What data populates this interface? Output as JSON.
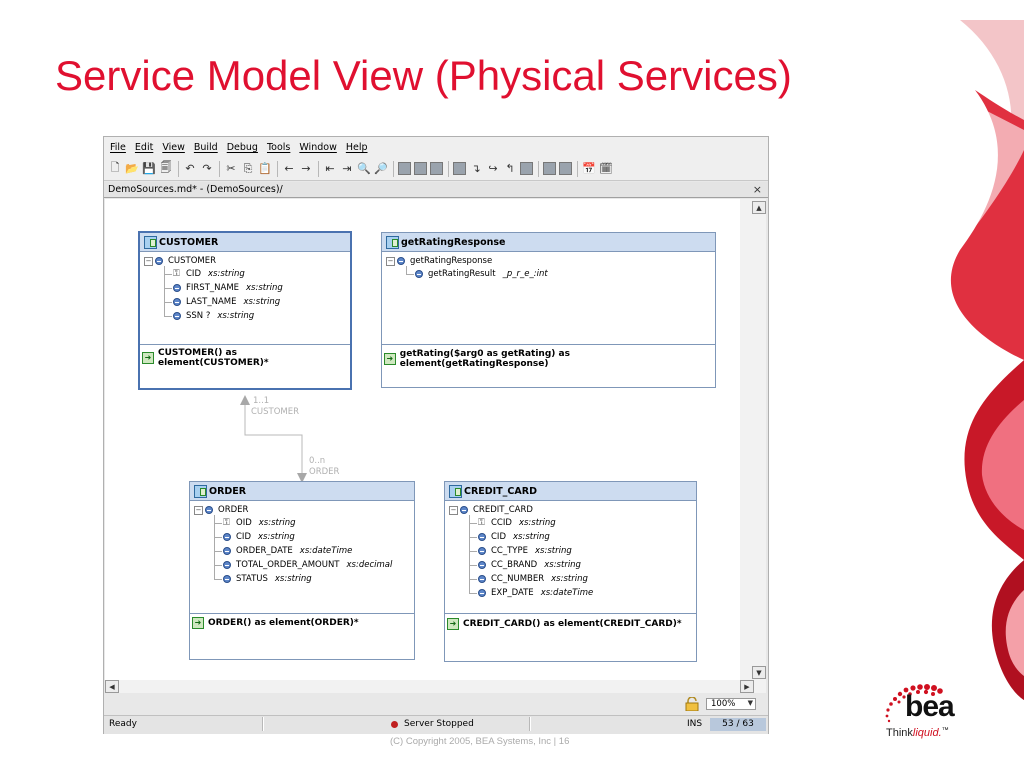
{
  "slide": {
    "title": "Service Model View (Physical Services)",
    "footer": "(C) Copyright 2005, BEA Systems, Inc   |   16",
    "logo": {
      "brand": "bea",
      "tagline_think": "Think",
      "tagline_liquid": "liquid.",
      "tm": "™"
    },
    "colors": {
      "title": "#e01030",
      "accent_red": "#d01020"
    }
  },
  "app": {
    "menu": [
      "File",
      "Edit",
      "View",
      "Build",
      "Debug",
      "Tools",
      "Window",
      "Help"
    ],
    "toolbar_icons": [
      "new-file-icon",
      "open-folder-icon",
      "save-icon",
      "save-all-icon",
      "undo-icon",
      "redo-icon",
      "cut-icon",
      "copy-icon",
      "paste-icon",
      "back-arrow-icon",
      "forward-arrow-icon",
      "indent-icon",
      "outdent-icon",
      "find-icon",
      "find-replace-icon",
      "build-icon",
      "build-all-icon",
      "stop-build-icon",
      "debug-icon",
      "step-into-icon",
      "step-over-icon",
      "step-out-icon",
      "breakpoint-icon",
      "watch-icon",
      "locals-icon",
      "calendar-icon",
      "deploy-icon"
    ],
    "tab": {
      "label": "DemoSources.md* - (DemoSources)/",
      "close": "×"
    },
    "zoom": "100%",
    "status": {
      "ready": "Ready",
      "server": "Server Stopped",
      "ins": "INS",
      "page": "53 / 63"
    }
  },
  "diagram": {
    "customer": {
      "title": "CUSTOMER",
      "root": "CUSTOMER",
      "fields": [
        {
          "name": "CID",
          "type": "xs:string",
          "key": true
        },
        {
          "name": "FIRST_NAME",
          "type": "xs:string",
          "key": false
        },
        {
          "name": "LAST_NAME",
          "type": "xs:string",
          "key": false
        },
        {
          "name": "SSN ?",
          "type": "xs:string",
          "key": false
        }
      ],
      "function": "CUSTOMER() as element(CUSTOMER)*"
    },
    "rating": {
      "title": "getRatingResponse",
      "root": "getRatingResponse",
      "fields": [
        {
          "name": "getRatingResult",
          "type": "_p_r_e_:int",
          "key": false
        }
      ],
      "function": "getRating($arg0 as getRating) as element(getRatingResponse)"
    },
    "order": {
      "title": "ORDER",
      "root": "ORDER",
      "fields": [
        {
          "name": "OID",
          "type": "xs:string",
          "key": true
        },
        {
          "name": "CID",
          "type": "xs:string",
          "key": false
        },
        {
          "name": "ORDER_DATE",
          "type": "xs:dateTime",
          "key": false
        },
        {
          "name": "TOTAL_ORDER_AMOUNT",
          "type": "xs:decimal",
          "key": false
        },
        {
          "name": "STATUS",
          "type": "xs:string",
          "key": false
        }
      ],
      "function": "ORDER() as element(ORDER)*"
    },
    "credit": {
      "title": "CREDIT_CARD",
      "root": "CREDIT_CARD",
      "fields": [
        {
          "name": "CCID",
          "type": "xs:string",
          "key": true
        },
        {
          "name": "CID",
          "type": "xs:string",
          "key": false
        },
        {
          "name": "CC_TYPE",
          "type": "xs:string",
          "key": false
        },
        {
          "name": "CC_BRAND",
          "type": "xs:string",
          "key": false
        },
        {
          "name": "CC_NUMBER",
          "type": "xs:string",
          "key": false
        },
        {
          "name": "EXP_DATE",
          "type": "xs:dateTime",
          "key": false
        }
      ],
      "function": "CREDIT_CARD() as element(CREDIT_CARD)*"
    },
    "relationship": {
      "top_cardinality": "1..1",
      "top_label": "CUSTOMER",
      "bottom_cardinality": "0..n",
      "bottom_label": "ORDER"
    }
  }
}
